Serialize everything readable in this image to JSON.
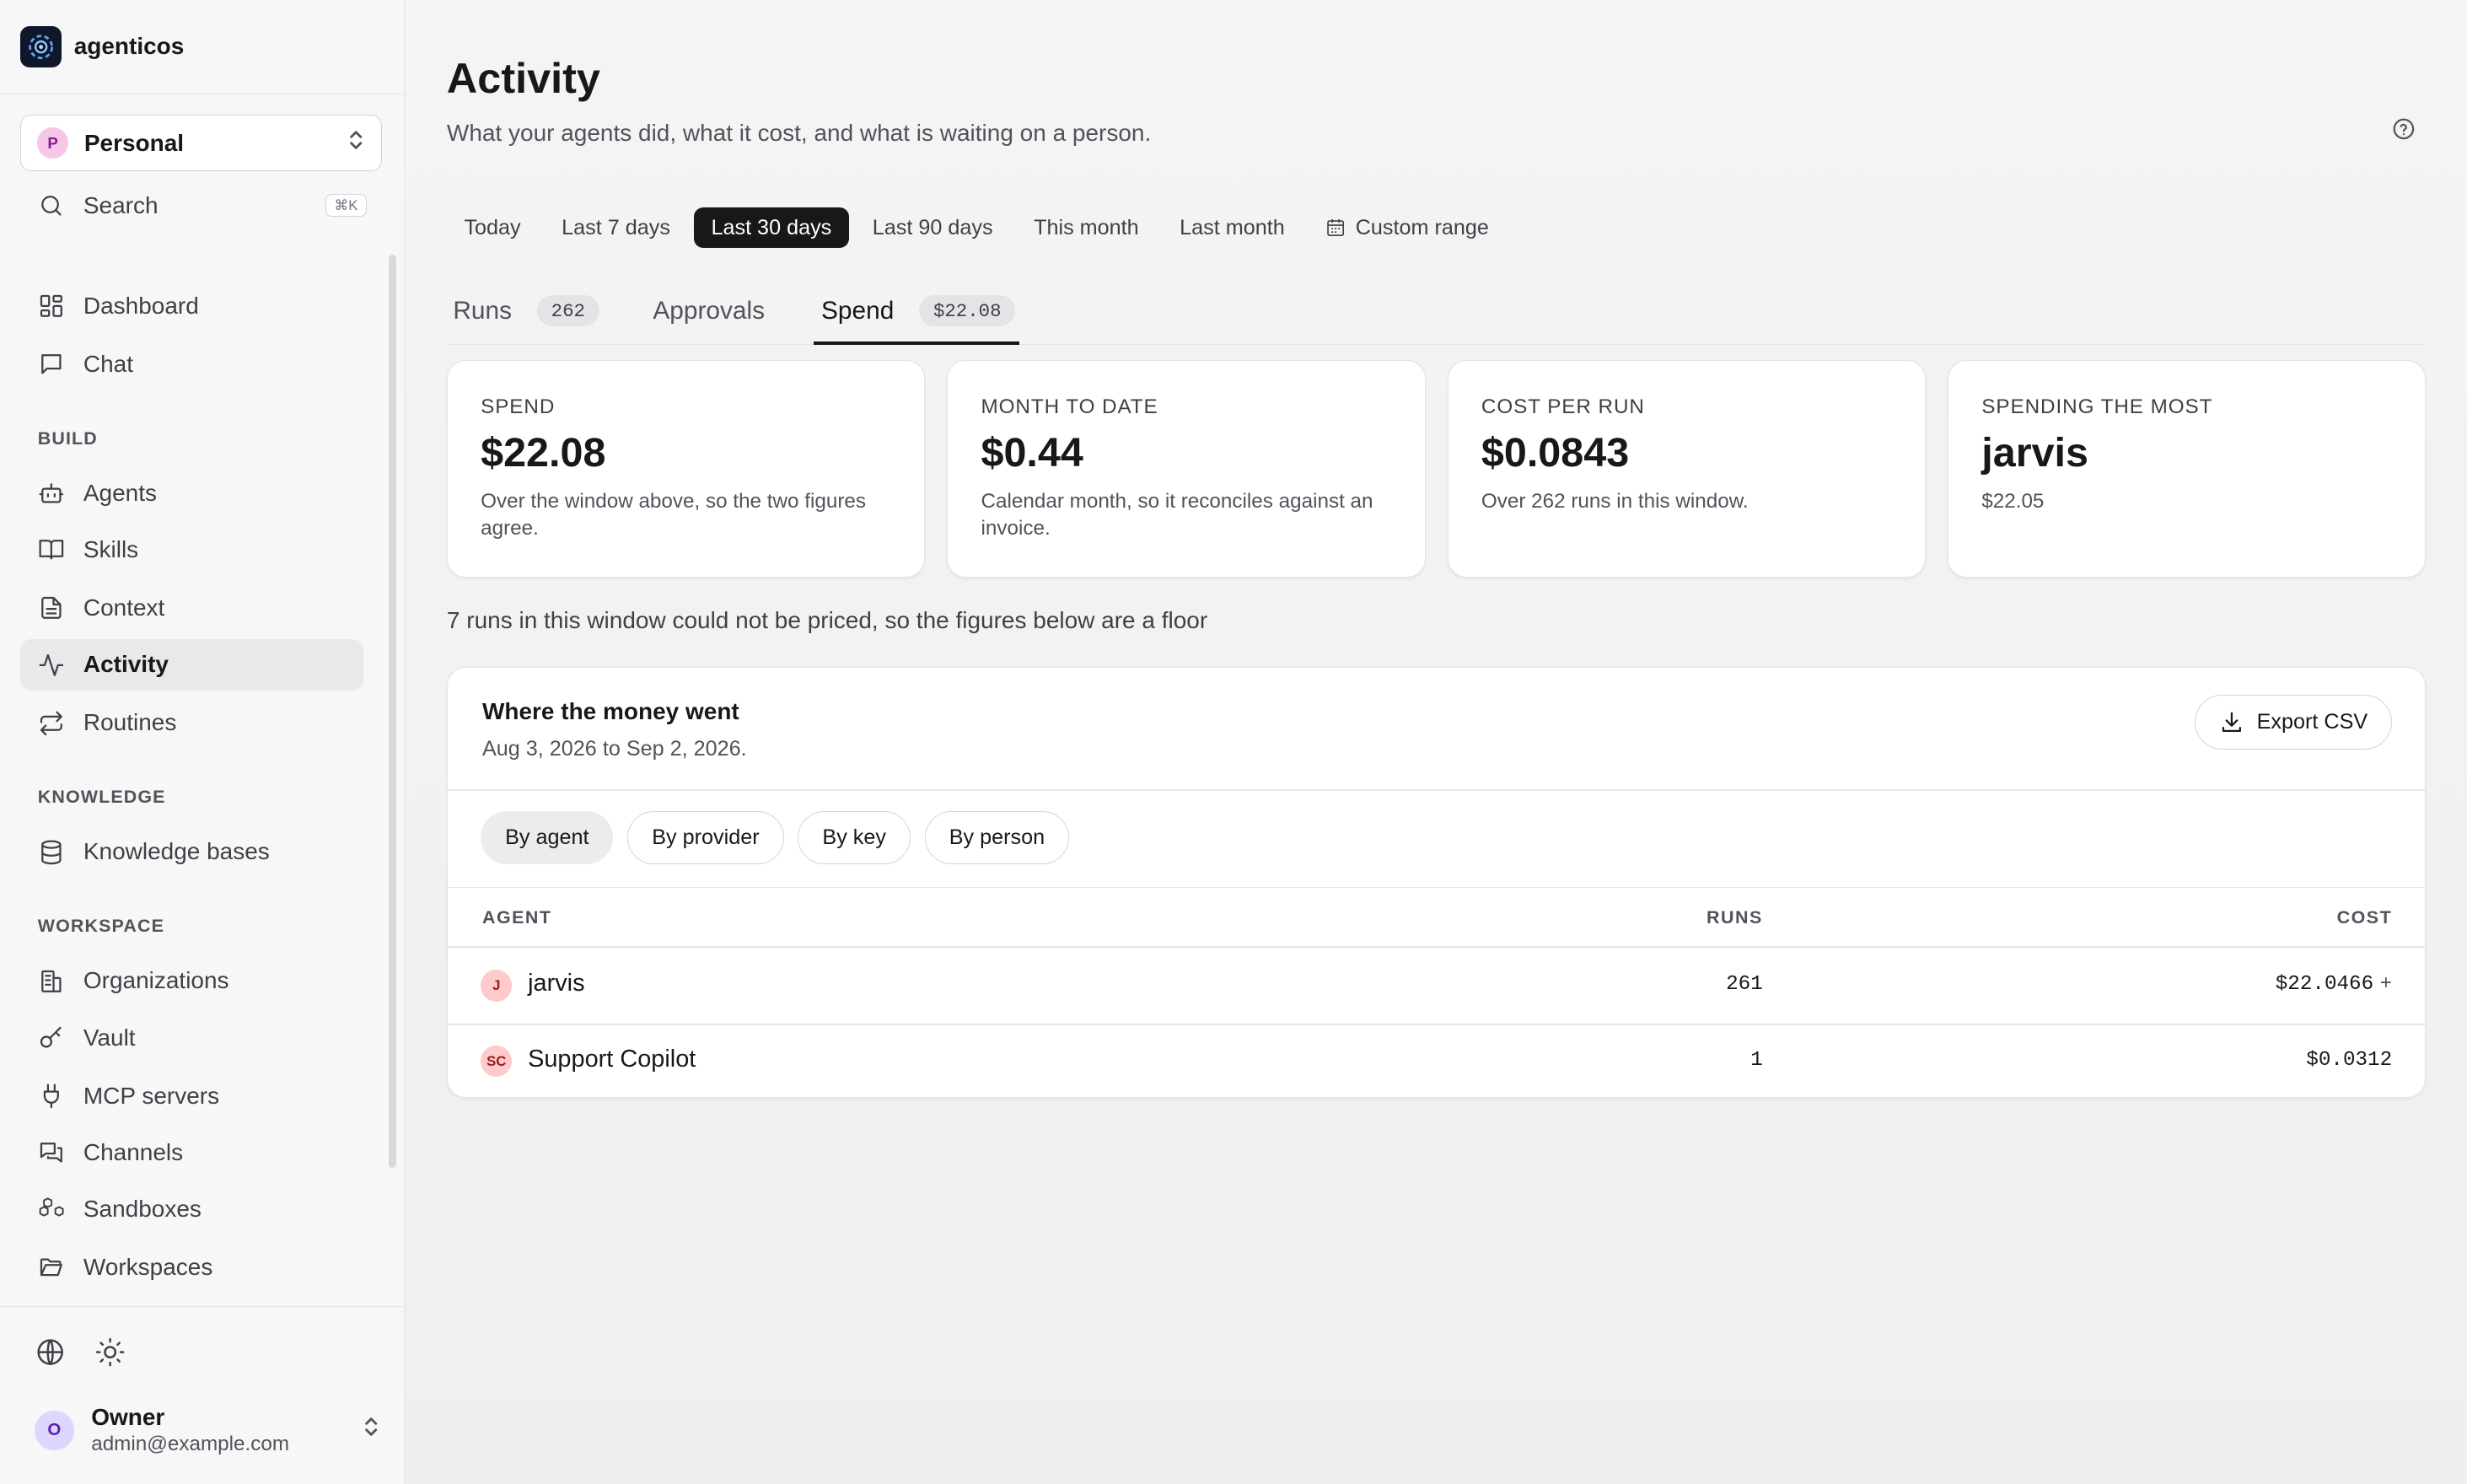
{
  "brand": {
    "name": "agenticos"
  },
  "workspace": {
    "initial": "P",
    "name": "Personal"
  },
  "search": {
    "label": "Search",
    "shortcut": "⌘K"
  },
  "nav": {
    "dashboard": "Dashboard",
    "chat": "Chat",
    "build_heading": "BUILD",
    "agents": "Agents",
    "skills": "Skills",
    "context": "Context",
    "activity": "Activity",
    "routines": "Routines",
    "knowledge_heading": "KNOWLEDGE",
    "knowledge_bases": "Knowledge bases",
    "workspace_heading": "WORKSPACE",
    "organizations": "Organizations",
    "vault": "Vault",
    "mcp_servers": "MCP servers",
    "channels": "Channels",
    "sandboxes": "Sandboxes",
    "workspaces": "Workspaces"
  },
  "user": {
    "initial": "O",
    "name": "Owner",
    "email": "admin@example.com"
  },
  "page": {
    "title": "Activity",
    "subtitle": "What your agents did, what it cost, and what is waiting on a person."
  },
  "ranges": [
    "Today",
    "Last 7 days",
    "Last 30 days",
    "Last 90 days",
    "This month",
    "Last month",
    "Custom range"
  ],
  "selected_range": "Last 30 days",
  "tabs": {
    "runs": {
      "label": "Runs",
      "badge": "262"
    },
    "approvals": {
      "label": "Approvals"
    },
    "spend": {
      "label": "Spend",
      "badge": "$22.08"
    }
  },
  "cards": [
    {
      "label": "SPEND",
      "value": "$22.08",
      "sub": "Over the window above, so the two figures agree."
    },
    {
      "label": "MONTH TO DATE",
      "value": "$0.44",
      "sub": "Calendar month, so it reconciles against an invoice."
    },
    {
      "label": "COST PER RUN",
      "value": "$0.0843",
      "sub": "Over 262 runs in this window."
    },
    {
      "label": "SPENDING THE MOST",
      "value": "jarvis",
      "sub": "$22.05"
    }
  ],
  "floor_note": "7 runs in this window could not be priced, so the figures below are a floor",
  "breakdown": {
    "title": "Where the money went",
    "date_range": "Aug 3, 2026 to Sep 2, 2026.",
    "export_label": "Export CSV",
    "groupings": [
      "By agent",
      "By provider",
      "By key",
      "By person"
    ],
    "columns": {
      "agent": "AGENT",
      "runs": "RUNS",
      "cost": "COST"
    },
    "rows": [
      {
        "initials": "J",
        "agent": "jarvis",
        "runs": "261",
        "cost": "$22.0466",
        "marker": "+"
      },
      {
        "initials": "SC",
        "agent": "Support Copilot",
        "runs": "1",
        "cost": "$0.0312"
      }
    ]
  }
}
